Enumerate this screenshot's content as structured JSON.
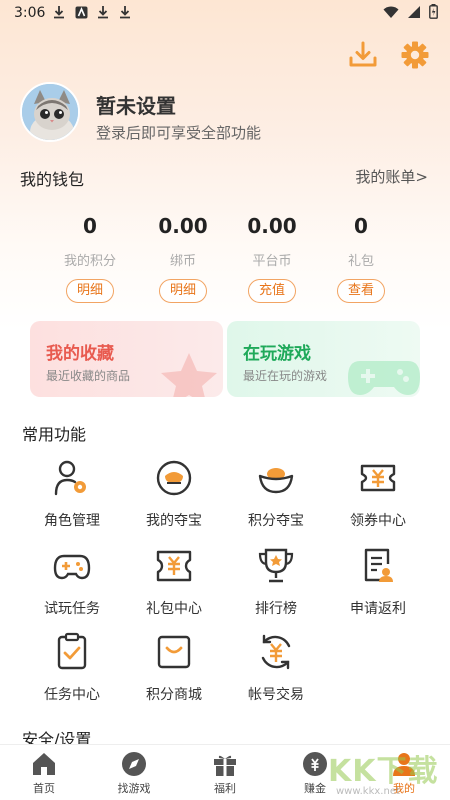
{
  "status": {
    "time": "3:06"
  },
  "profile": {
    "name": "暂未设置",
    "subtitle": "登录后即可享受全部功能"
  },
  "wallet": {
    "title": "我的钱包",
    "link": "我的账单>",
    "stats": [
      {
        "value": "0",
        "label": "我的积分",
        "button": "明细"
      },
      {
        "value": "0.00",
        "label": "绑币",
        "button": "明细"
      },
      {
        "value": "0.00",
        "label": "平台币",
        "button": "充值"
      },
      {
        "value": "0",
        "label": "礼包",
        "button": "查看"
      }
    ]
  },
  "cards": {
    "favorites": {
      "title": "我的收藏",
      "subtitle": "最近收藏的商品"
    },
    "playing": {
      "title": "在玩游戏",
      "subtitle": "最近在玩的游戏"
    }
  },
  "common": {
    "title": "常用功能",
    "items": [
      {
        "label": "角色管理",
        "icon": "role-icon"
      },
      {
        "label": "我的夺宝",
        "icon": "treasure-coin-icon"
      },
      {
        "label": "积分夺宝",
        "icon": "ingot-icon"
      },
      {
        "label": "领券中心",
        "icon": "coupon-icon"
      },
      {
        "label": "试玩任务",
        "icon": "gamepad-icon"
      },
      {
        "label": "礼包中心",
        "icon": "gift-ticket-icon"
      },
      {
        "label": "排行榜",
        "icon": "trophy-icon"
      },
      {
        "label": "申请返利",
        "icon": "rebate-doc-icon"
      },
      {
        "label": "任务中心",
        "icon": "task-check-icon"
      },
      {
        "label": "积分商城",
        "icon": "shop-bag-icon"
      },
      {
        "label": "帐号交易",
        "icon": "account-trade-icon"
      }
    ]
  },
  "safety": {
    "title": "安全/设置"
  },
  "nav": [
    {
      "label": "首页",
      "icon": "home-icon"
    },
    {
      "label": "找游戏",
      "icon": "compass-icon"
    },
    {
      "label": "福利",
      "icon": "gift-icon"
    },
    {
      "label": "赚金",
      "icon": "money-bag-icon"
    },
    {
      "label": "我的",
      "icon": "user-icon",
      "active": true
    }
  ],
  "watermark": {
    "text": "KK下载",
    "sub": "www.kkx.net"
  },
  "colors": {
    "accent": "#e8751a",
    "icon_orange": "#f29b38",
    "text_dark": "#333333"
  }
}
